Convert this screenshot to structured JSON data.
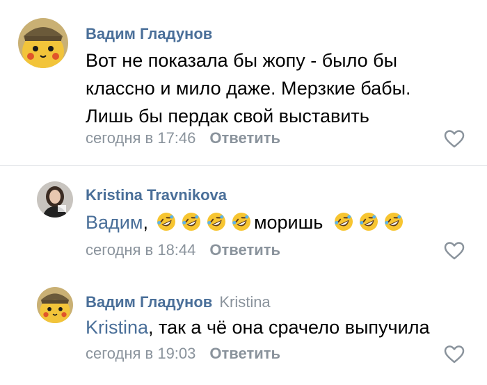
{
  "comments": [
    {
      "author": "Вадим Гладунов",
      "text_lines": [
        "Вот не показала бы жопу - было бы",
        "классно и мило даже. Мерзкие бабы.",
        "Лишь бы пердак свой выставить"
      ],
      "time": "сегодня в 17:46",
      "reply_label": "Ответить"
    },
    {
      "author": "Kristina Travnikova",
      "mention": "Вадим",
      "after_mention": ",",
      "text_middle": "моришь",
      "time": "сегодня в 18:44",
      "reply_label": "Ответить"
    },
    {
      "author": "Вадим Гладунов",
      "reply_to": "Kristina",
      "mention": "Kristina",
      "text": ", так а чё она срачело выпучила",
      "time": "сегодня в 19:03",
      "reply_label": "Ответить"
    }
  ],
  "icons": {
    "like": "heart-outline-icon",
    "emoji": "rolling-on-floor-laughing-emoji"
  },
  "colors": {
    "link": "#4a6f99",
    "muted": "#8a939c",
    "text": "#000000",
    "divider": "#dfe2e6"
  }
}
